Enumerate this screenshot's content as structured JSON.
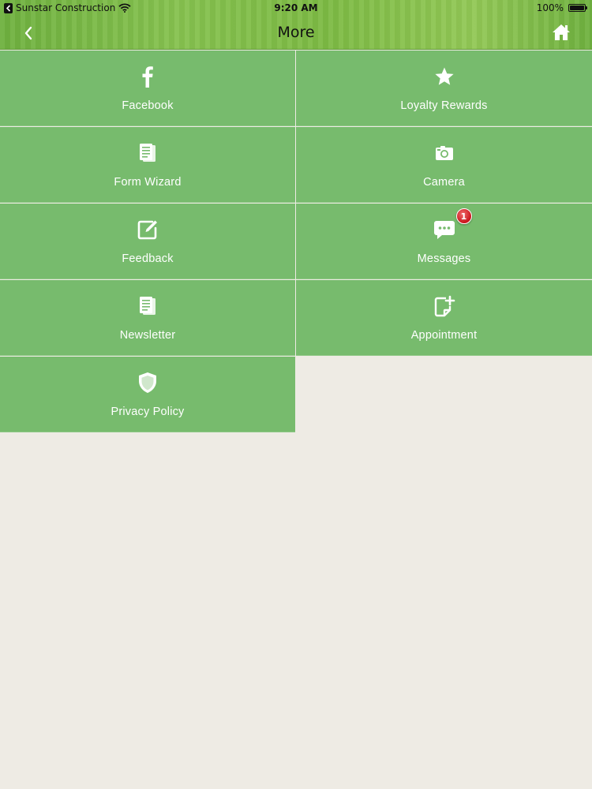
{
  "status_bar": {
    "carrier": "Sunstar Construction",
    "time": "9:20 AM",
    "battery": "100%"
  },
  "nav": {
    "title": "More",
    "back_icon": "chevron-left-icon",
    "home_icon": "home-icon"
  },
  "colors": {
    "header_green": "#7dbb44",
    "tile_green": "#77bb6d",
    "background": "#eeebe4",
    "badge_red": "#d0191f"
  },
  "menu": {
    "items": [
      {
        "label": "Facebook",
        "icon": "facebook-icon"
      },
      {
        "label": "Loyalty Rewards",
        "icon": "star-icon"
      },
      {
        "label": "Form Wizard",
        "icon": "document-icon"
      },
      {
        "label": "Camera",
        "icon": "camera-icon"
      },
      {
        "label": "Feedback",
        "icon": "edit-icon"
      },
      {
        "label": "Messages",
        "icon": "chat-bubble-icon",
        "badge": "1"
      },
      {
        "label": "Newsletter",
        "icon": "newspaper-icon"
      },
      {
        "label": "Appointment",
        "icon": "calendar-add-icon"
      },
      {
        "label": "Privacy Policy",
        "icon": "shield-icon"
      }
    ]
  }
}
